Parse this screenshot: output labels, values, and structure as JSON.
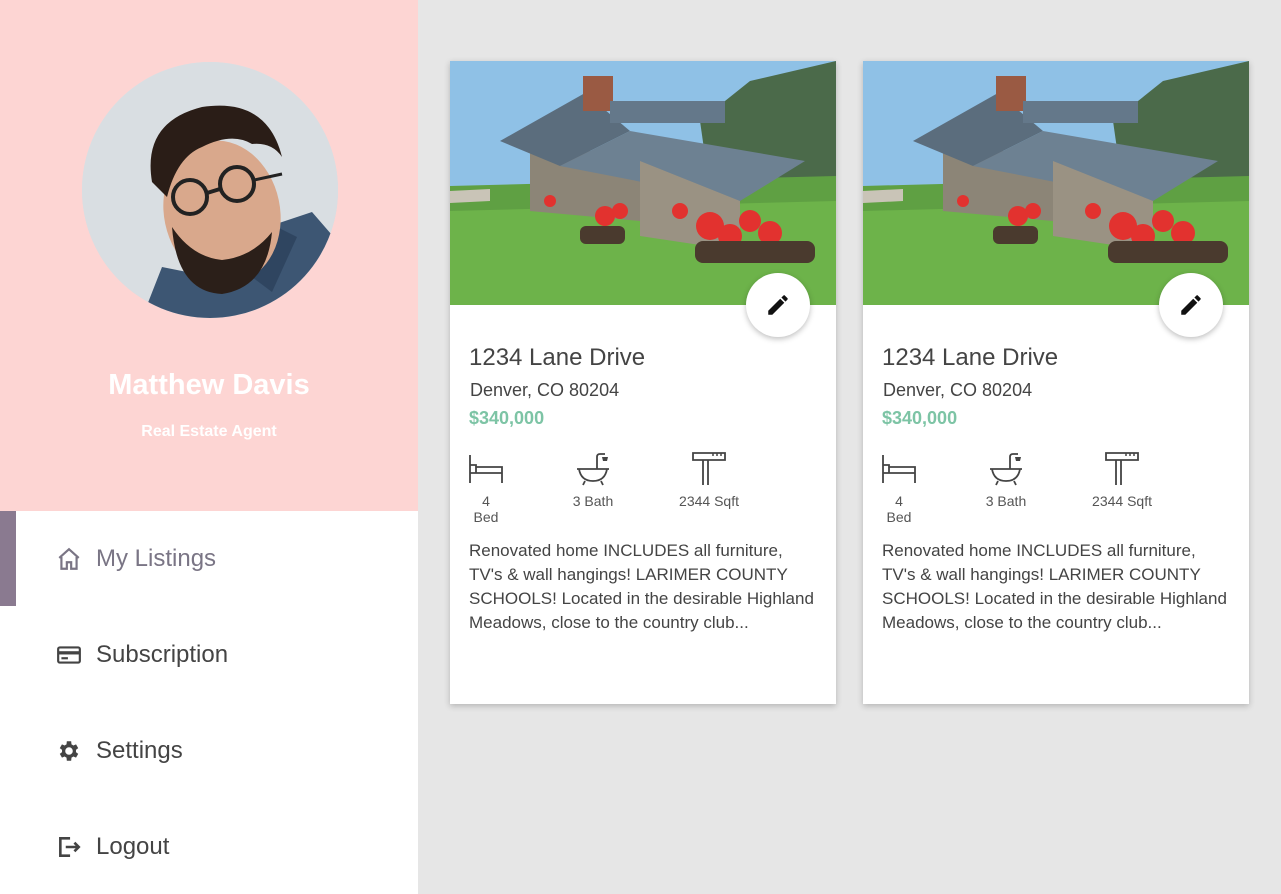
{
  "profile": {
    "name": "Matthew Davis",
    "role": "Real Estate Agent"
  },
  "nav": {
    "items": [
      {
        "label": "My Listings",
        "icon": "home-icon",
        "active": true
      },
      {
        "label": "Subscription",
        "icon": "credit-card-icon",
        "active": false
      },
      {
        "label": "Settings",
        "icon": "gear-icon",
        "active": false
      },
      {
        "label": "Logout",
        "icon": "logout-icon",
        "active": false
      }
    ]
  },
  "listings": [
    {
      "address": "1234 Lane Drive",
      "city": "Denver, CO 80204",
      "price": "$340,000",
      "bed": "4 Bed",
      "bath": "3 Bath",
      "sqft": "2344 Sqft",
      "description": "Renovated home INCLUDES all furniture, TV's & wall hangings!  LARIMER COUNTY SCHOOLS! Located in the desirable Highland Meadows, close to the country club..."
    },
    {
      "address": "1234 Lane Drive",
      "city": "Denver, CO 80204",
      "price": "$340,000",
      "bed": "4 Bed",
      "bath": "3 Bath",
      "sqft": "2344 Sqft",
      "description": "Renovated home INCLUDES all furniture, TV's & wall hangings! LARIMER COUNTY SCHOOLS! Located in the desirable Highland Meadows, close to the country club..."
    }
  ],
  "colors": {
    "profile_bg": "#fdd5d3",
    "active_indicator": "#8a7a90",
    "price": "#7dc4a5",
    "content_bg": "#e6e6e6"
  }
}
